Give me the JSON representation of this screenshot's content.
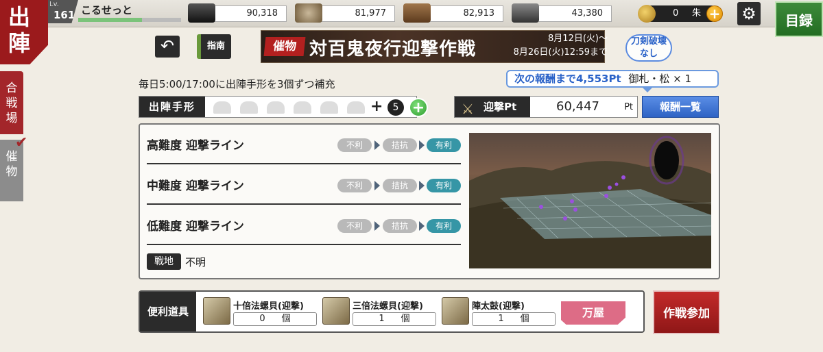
{
  "header": {
    "screen_title": "出陣",
    "level_label": "Lv.",
    "level": "161",
    "player_name": "こるせっと",
    "exp_progress": 0.62,
    "resources": [
      {
        "icon": "charcoal-icon",
        "value": "90,318"
      },
      {
        "icon": "tamahagane-icon",
        "value": "81,977"
      },
      {
        "icon": "cooling-material-icon",
        "value": "82,913"
      },
      {
        "icon": "whetstone-icon",
        "value": "43,380"
      }
    ],
    "coins": {
      "value": "0",
      "unit": "朱"
    },
    "catalog_label": "目録"
  },
  "side_tabs": [
    {
      "label": "合戦場",
      "active": true
    },
    {
      "label": "催物",
      "active": false
    }
  ],
  "event": {
    "tag": "催物",
    "name": "対百鬼夜行迎撃作戦",
    "period_start": "8月12日(火)〜",
    "period_end": "8月26日(火)12:59まで",
    "no_break_line1": "刀剣破壊",
    "no_break_line2": "なし"
  },
  "nav": {
    "guide_label": "指南"
  },
  "supply_note": "毎日5:00/17:00に出陣手形を3個ずつ補充",
  "reward_callout": {
    "next_label": "次の報酬まで4,553Pt",
    "reward": "御札・松 × 1"
  },
  "tickets": {
    "label": "出陣手形",
    "plus_sign": "+",
    "extra": "5",
    "slots": 6
  },
  "points": {
    "label": "迎撃Pt",
    "value": "60,447",
    "unit": "Pt"
  },
  "reward_list_label": "報酬一覧",
  "lines": [
    {
      "name": "高難度 迎撃ライン",
      "states": [
        "不利",
        "拮抗",
        "有利"
      ]
    },
    {
      "name": "中難度 迎撃ライン",
      "states": [
        "不利",
        "拮抗",
        "有利"
      ]
    },
    {
      "name": "低難度 迎撃ライン",
      "states": [
        "不利",
        "拮抗",
        "有利"
      ]
    }
  ],
  "battlefield": {
    "label": "戦地",
    "value": "不明"
  },
  "items": {
    "label": "便利道具",
    "list": [
      {
        "name": "十倍法螺貝(迎撃)",
        "count": "0",
        "unit": "個"
      },
      {
        "name": "三倍法螺貝(迎撃)",
        "count": "1",
        "unit": "個"
      },
      {
        "name": "陣太鼓(迎撃)",
        "count": "1",
        "unit": "個"
      }
    ]
  },
  "shop_label": "万屋",
  "sortie_label": "作戦参加",
  "colors": {
    "brand_red": "#9b1a1c",
    "advantage_teal": "#3696a6",
    "reward_blue": "#2e63c4",
    "catalog_green": "#2f7a2c"
  }
}
